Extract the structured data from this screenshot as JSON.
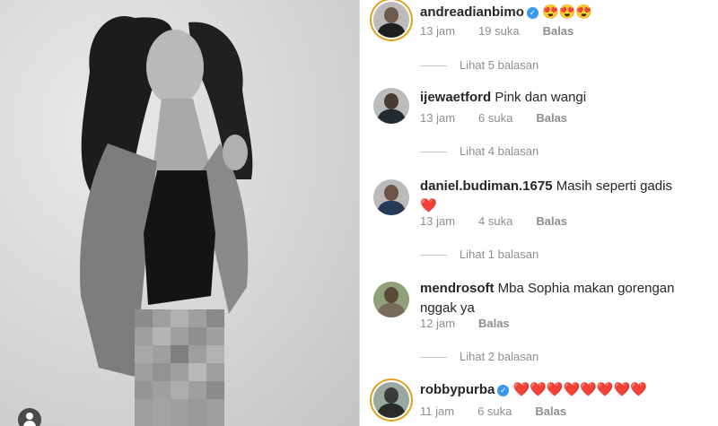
{
  "comments": [
    {
      "username": "andreadianbimo",
      "verified": true,
      "text": "😍😍😍",
      "time": "13 jam",
      "likes": "19 suka",
      "reply": "Balas",
      "view_replies": "Lihat 5 balasan"
    },
    {
      "username": "ijewaetford",
      "verified": false,
      "text": "Pink dan wangi",
      "time": "13 jam",
      "likes": "6 suka",
      "reply": "Balas",
      "view_replies": "Lihat 4 balasan"
    },
    {
      "username": "daniel.budiman.1675",
      "verified": false,
      "text": "Masih seperti gadis",
      "text2": "❤️",
      "time": "13 jam",
      "likes": "4 suka",
      "reply": "Balas",
      "view_replies": "Lihat 1 balasan"
    },
    {
      "username": "mendrosoft",
      "verified": false,
      "text": "Mba Sophia makan gorengan nggak ya",
      "time": "12 jam",
      "reply": "Balas",
      "view_replies": "Lihat 2 balasan"
    },
    {
      "username": "robbypurba",
      "verified": true,
      "text": "❤️❤️❤️❤️❤️❤️❤️❤️",
      "time": "11 jam",
      "likes": "6 suka",
      "reply": "Balas"
    }
  ],
  "colors": {
    "verified": "#3897f0",
    "muted": "#8e8e8e",
    "story_ring": "#e3a021"
  },
  "icons": {
    "verified": "verified-badge-icon",
    "user_tag": "user-tag-icon"
  }
}
